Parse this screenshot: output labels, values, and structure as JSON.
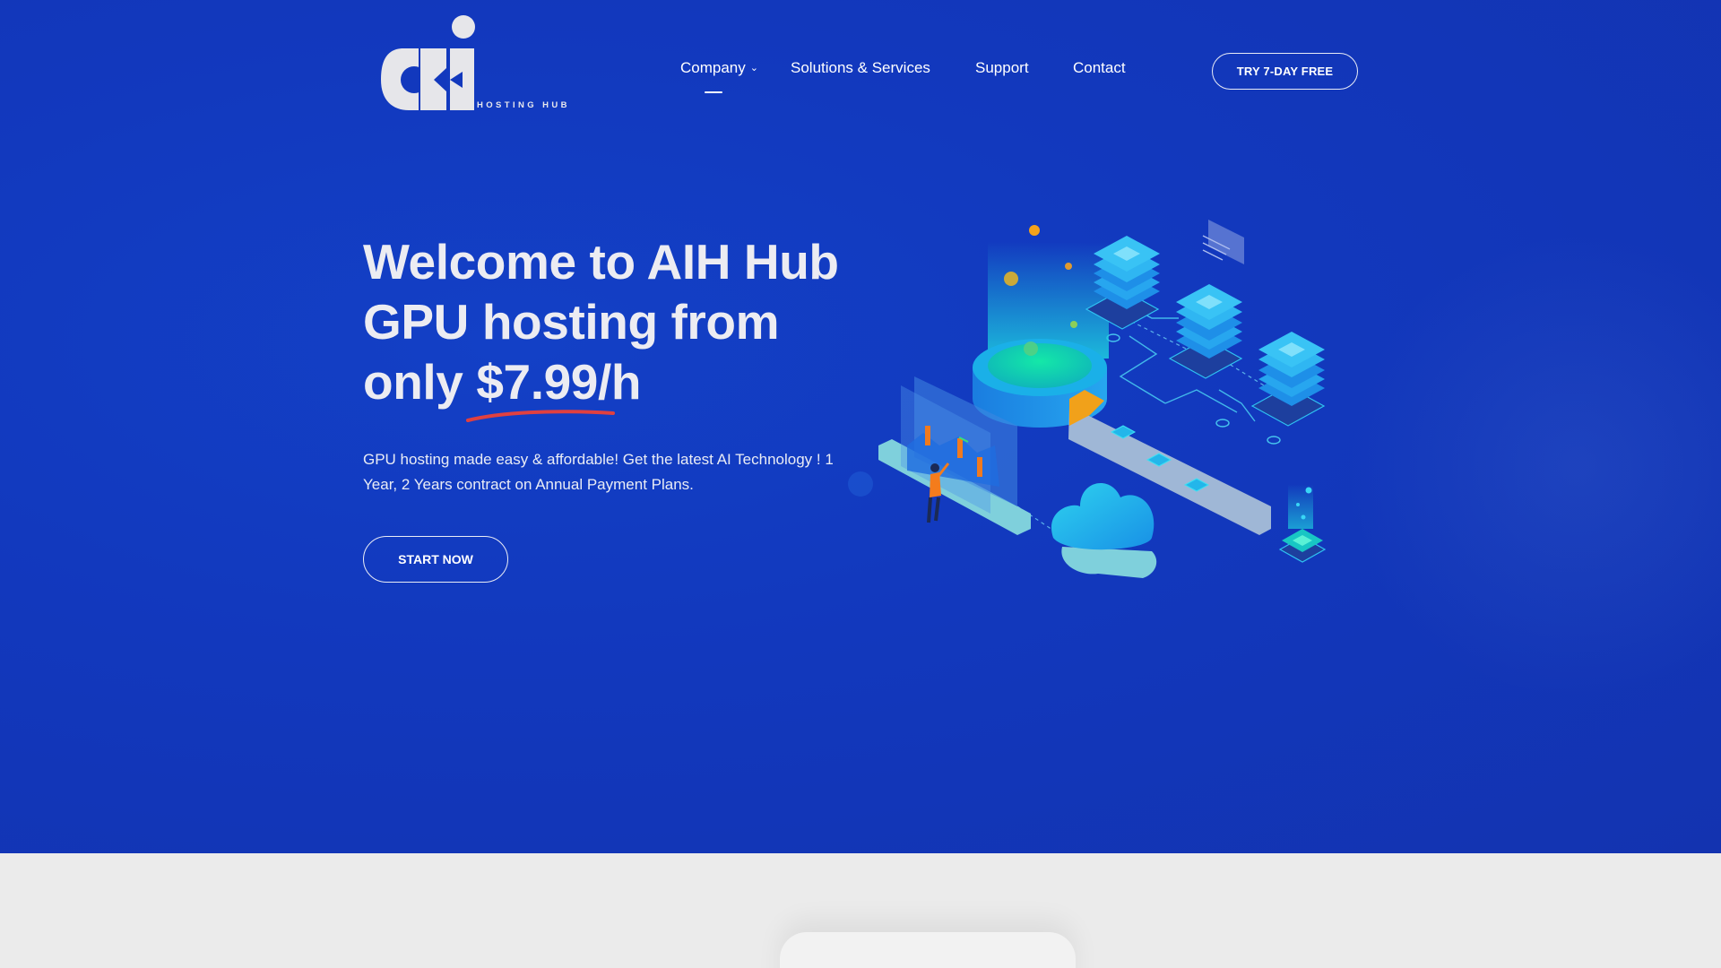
{
  "brand": {
    "logo_tagline": "HOSTING HUB"
  },
  "nav": {
    "items": [
      {
        "label": "Company"
      },
      {
        "label": "Solutions & Services"
      },
      {
        "label": "Support"
      },
      {
        "label": "Contact"
      }
    ],
    "company_chevron": "⌄",
    "cta_label": "TRY 7-DAY FREE"
  },
  "hero": {
    "headline_line1": "Welcome to AIH Hub",
    "headline_line2": "GPU hosting from",
    "headline_line3": "only $7.99/h",
    "description": "GPU hosting made easy & affordable! Get the latest AI Technology ! 1 Year, 2 Years contract on Annual Payment Plans.",
    "cta_label": "START NOW"
  },
  "colors": {
    "hero_background": "#1238bd",
    "underline_accent": "#e04040",
    "lower_background": "#ebebeb"
  }
}
